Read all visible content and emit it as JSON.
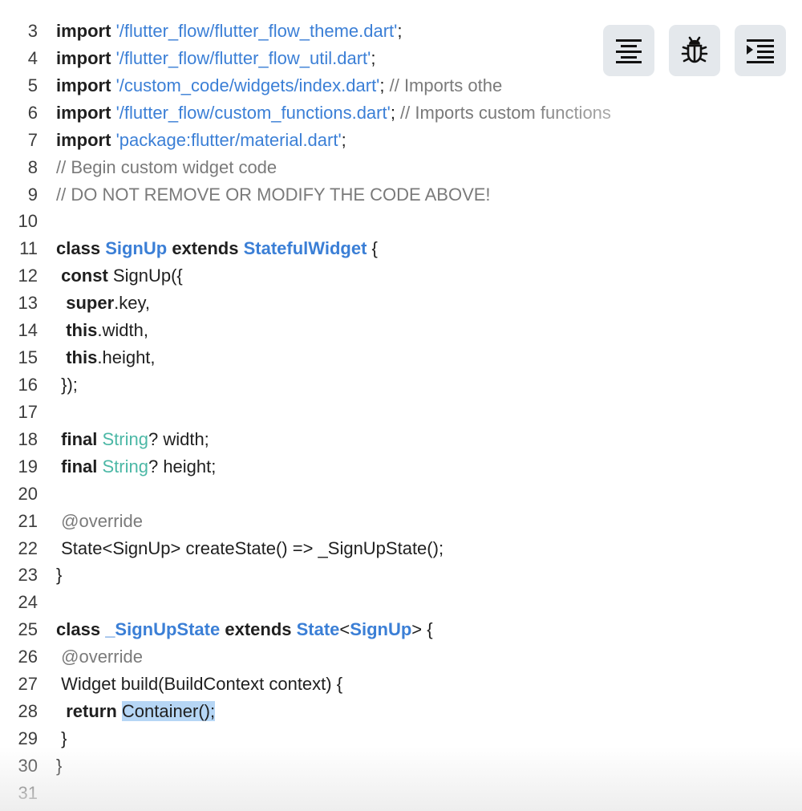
{
  "editor": {
    "language": "dart",
    "selected_text": "Container();",
    "lines": [
      {
        "number": "3",
        "tokens": [
          {
            "t": "kw",
            "v": "import"
          },
          {
            "t": "pl",
            "v": " "
          },
          {
            "t": "str",
            "v": "'/flutter_flow/flutter_flow_theme.dart'"
          },
          {
            "t": "pl",
            "v": ";"
          }
        ]
      },
      {
        "number": "4",
        "tokens": [
          {
            "t": "kw",
            "v": "import"
          },
          {
            "t": "pl",
            "v": " "
          },
          {
            "t": "str",
            "v": "'/flutter_flow/flutter_flow_util.dart'"
          },
          {
            "t": "pl",
            "v": ";"
          }
        ]
      },
      {
        "number": "5",
        "tokens": [
          {
            "t": "kw",
            "v": "import"
          },
          {
            "t": "pl",
            "v": " "
          },
          {
            "t": "str",
            "v": "'/custom_code/widgets/index.dart'"
          },
          {
            "t": "pl",
            "v": "; "
          },
          {
            "t": "cm",
            "v": "// Imports othe"
          }
        ]
      },
      {
        "number": "6",
        "tokens": [
          {
            "t": "kw",
            "v": "import"
          },
          {
            "t": "pl",
            "v": " "
          },
          {
            "t": "str",
            "v": "'/flutter_flow/custom_functions.dart'"
          },
          {
            "t": "pl",
            "v": "; "
          },
          {
            "t": "cm",
            "v": "// Imports custom functions"
          }
        ]
      },
      {
        "number": "7",
        "tokens": [
          {
            "t": "kw",
            "v": "import"
          },
          {
            "t": "pl",
            "v": " "
          },
          {
            "t": "str",
            "v": "'package:flutter/material.dart'"
          },
          {
            "t": "pl",
            "v": ";"
          }
        ]
      },
      {
        "number": "8",
        "tokens": [
          {
            "t": "cm",
            "v": "// Begin custom widget code"
          }
        ]
      },
      {
        "number": "9",
        "tokens": [
          {
            "t": "cm",
            "v": "// DO NOT REMOVE OR MODIFY THE CODE ABOVE!"
          }
        ]
      },
      {
        "number": "10",
        "tokens": []
      },
      {
        "number": "11",
        "tokens": [
          {
            "t": "kw",
            "v": "class"
          },
          {
            "t": "pl",
            "v": " "
          },
          {
            "t": "ty",
            "v": "SignUp"
          },
          {
            "t": "pl",
            "v": " "
          },
          {
            "t": "kw",
            "v": "extends"
          },
          {
            "t": "pl",
            "v": " "
          },
          {
            "t": "ty",
            "v": "StatefulWidget"
          },
          {
            "t": "pl",
            "v": " {"
          }
        ]
      },
      {
        "number": "12",
        "tokens": [
          {
            "t": "pl",
            "v": " "
          },
          {
            "t": "kw",
            "v": "const"
          },
          {
            "t": "pl",
            "v": " SignUp({"
          }
        ]
      },
      {
        "number": "13",
        "tokens": [
          {
            "t": "pl",
            "v": "  "
          },
          {
            "t": "kw",
            "v": "super"
          },
          {
            "t": "pl",
            "v": ".key,"
          }
        ]
      },
      {
        "number": "14",
        "tokens": [
          {
            "t": "pl",
            "v": "  "
          },
          {
            "t": "kw",
            "v": "this"
          },
          {
            "t": "pl",
            "v": ".width,"
          }
        ]
      },
      {
        "number": "15",
        "tokens": [
          {
            "t": "pl",
            "v": "  "
          },
          {
            "t": "kw",
            "v": "this"
          },
          {
            "t": "pl",
            "v": ".height,"
          }
        ]
      },
      {
        "number": "16",
        "tokens": [
          {
            "t": "pl",
            "v": " });"
          }
        ]
      },
      {
        "number": "17",
        "tokens": []
      },
      {
        "number": "18",
        "tokens": [
          {
            "t": "pl",
            "v": " "
          },
          {
            "t": "kw",
            "v": "final"
          },
          {
            "t": "pl",
            "v": " "
          },
          {
            "t": "bi",
            "v": "String"
          },
          {
            "t": "pl",
            "v": "? width;"
          }
        ]
      },
      {
        "number": "19",
        "tokens": [
          {
            "t": "pl",
            "v": " "
          },
          {
            "t": "kw",
            "v": "final"
          },
          {
            "t": "pl",
            "v": " "
          },
          {
            "t": "bi",
            "v": "String"
          },
          {
            "t": "pl",
            "v": "? height;"
          }
        ]
      },
      {
        "number": "20",
        "tokens": []
      },
      {
        "number": "21",
        "tokens": [
          {
            "t": "pl",
            "v": " "
          },
          {
            "t": "an",
            "v": "@override"
          }
        ]
      },
      {
        "number": "22",
        "tokens": [
          {
            "t": "pl",
            "v": " State<SignUp> createState() => _SignUpState();"
          }
        ]
      },
      {
        "number": "23",
        "tokens": [
          {
            "t": "pl",
            "v": "}"
          }
        ]
      },
      {
        "number": "24",
        "tokens": []
      },
      {
        "number": "25",
        "tokens": [
          {
            "t": "kw",
            "v": "class"
          },
          {
            "t": "pl",
            "v": " "
          },
          {
            "t": "ty",
            "v": "_SignUpState"
          },
          {
            "t": "pl",
            "v": " "
          },
          {
            "t": "kw",
            "v": "extends"
          },
          {
            "t": "pl",
            "v": " "
          },
          {
            "t": "ty",
            "v": "State"
          },
          {
            "t": "pl",
            "v": "<"
          },
          {
            "t": "ty",
            "v": "SignUp"
          },
          {
            "t": "pl",
            "v": "> {"
          }
        ]
      },
      {
        "number": "26",
        "tokens": [
          {
            "t": "pl",
            "v": " "
          },
          {
            "t": "an",
            "v": "@override"
          }
        ]
      },
      {
        "number": "27",
        "tokens": [
          {
            "t": "pl",
            "v": " Widget build(BuildContext context) {"
          }
        ]
      },
      {
        "number": "28",
        "tokens": [
          {
            "t": "pl",
            "v": "  "
          },
          {
            "t": "kw",
            "v": "return"
          },
          {
            "t": "pl",
            "v": " "
          },
          {
            "t": "sel",
            "v": "Container();"
          }
        ]
      },
      {
        "number": "29",
        "tokens": [
          {
            "t": "pl",
            "v": " }"
          }
        ]
      },
      {
        "number": "30",
        "tokens": [
          {
            "t": "pl",
            "v": "}"
          }
        ]
      },
      {
        "number": "31",
        "tokens": []
      }
    ]
  },
  "toolbar": {
    "buttons": [
      {
        "name": "format-code-button",
        "icon": "align-center-icon"
      },
      {
        "name": "debug-button",
        "icon": "bug-icon"
      },
      {
        "name": "indent-button",
        "icon": "indent-icon"
      }
    ]
  },
  "colors": {
    "keyword": "#1f1f1f",
    "string": "#3b7fd6",
    "comment": "#7a7a7a",
    "type": "#3b7fd6",
    "builtin_type": "#4cb8a6",
    "selection": "#b6d6f5",
    "toolbar_button_bg": "#e4e8ec"
  }
}
